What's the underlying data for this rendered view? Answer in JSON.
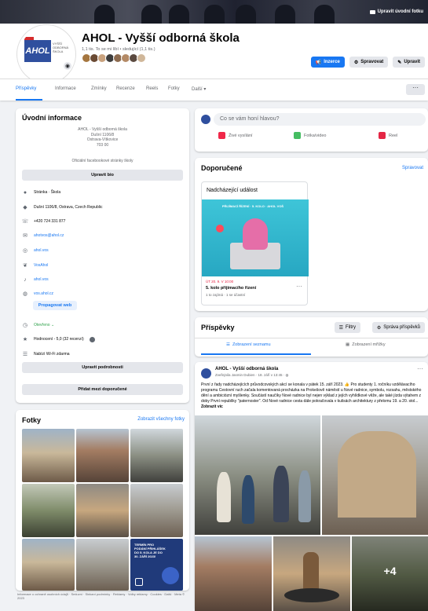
{
  "cover": {
    "button": "Upravit úvodní fotku"
  },
  "page": {
    "name": "AHOL - Vyšší odborná škola",
    "stats": "1,1 tis. To se mi líbí • sledující (1,1 tis.)",
    "logo_text": "AHOL",
    "logo_subtitle": "VYŠŠÍ ODBORNÁ ŠKOLA"
  },
  "header_buttons": {
    "primary": "Inzerce",
    "manage": "Spravovat",
    "edit": "Upravit"
  },
  "tabs": [
    "Příspěvky",
    "Informace",
    "Zmínky",
    "Recenze",
    "Reels",
    "Fotky",
    "Další ▾"
  ],
  "intro": {
    "title": "Úvodní informace",
    "bio_lines": [
      "AHOL - Vyšší odborná škola",
      "Dušní 1106/8",
      "Ostrava-Vítkovice",
      "703 00"
    ],
    "bio_note": "Oficiální facebookové stránky školy",
    "edit_bio": "Upravit bio",
    "rows": [
      {
        "icon": "info-icon",
        "text": "Stránka · Škola"
      },
      {
        "icon": "location-icon",
        "text": "Dušní 1106/8, Ostrava, Czech Republic"
      },
      {
        "icon": "phone-icon",
        "text": "+420 724 331 877"
      },
      {
        "icon": "mail-icon",
        "text": "ahotvos@ahol.cz"
      },
      {
        "icon": "instagram-icon",
        "text": "ahol.vos"
      },
      {
        "icon": "twitter-icon",
        "text": "VosAhol"
      },
      {
        "icon": "tiktok-icon",
        "text": "ahol.vos"
      },
      {
        "icon": "globe-icon",
        "text": "vos.ahol.cz"
      }
    ],
    "promote_web": "Propagovat web",
    "open_status": "Otevřeno ⌄",
    "rating": "Hodnocení - 5,0 (32 recenzí)",
    "wifi": "Nabízí Wi-Fi zdarma",
    "edit_details": "Upravit podrobnosti",
    "add_featured": "Přidat mezi doporučené"
  },
  "photos": {
    "title": "Fotky",
    "see_all": "Zobrazit všechny fotky",
    "promo_text": "TERMÍN PRO PODÁNÍ PŘIHLÁŠEK DO 5. KOLA JE DO 30. ZÁŘÍ 2023!"
  },
  "footer": "Informace o ochraně osobních údajů · Smluvní · Sinkaní podmínky · Reklamy · Volby reklamy · Cookies · Další · Meta © 2023",
  "composer": {
    "placeholder": "Co se vám honí hlavou?",
    "live": "Živé vysílání",
    "photo": "Fotka/video",
    "reel": "Reel"
  },
  "featured": {
    "title": "Doporučené",
    "manage": "Spravovat",
    "card_title": "Nadcházející událost",
    "event_image_text": "PŘIJÍMACÍ ŘÍZENÍ · 5. KOLO · AHOL VOŠ",
    "event_date": "ÚT 20. 9. V 10:00",
    "event_name": "5. kolo přijímacího řízení",
    "event_meta": "1 to zajímá · 1 se účastní"
  },
  "posts": {
    "title": "Příspěvky",
    "filters": "Filtry",
    "manage": "Správa příspěvků",
    "list_view": "Zobrazení seznamu",
    "grid_view": "Zobrazení mřížky",
    "post": {
      "author": "AHOL - Vyšší odborná škola",
      "meta": "Zveřejnila Jasmin Dubien · 18. září v 13:45 · ◍",
      "text": "První z řady nadcházejících průvodcovských akcí se konala v pátek 15. září 2023. 👍 Pro studenty 1. ročníku vzdělávacího programu Cestovní ruch začala komentovaná procházka na Prokešově náměstí u Nové radnice, symbolu, rozsahu, městského dění a ambiciózní myšlenky. Součástí naučíky Nové radnice byl nejen výklad z jejích vyhlídkové věže, ale také jízda výtahem z doby První republiky \"paternoster\". Od Nové radnice cesta dále pokračovala v kulisách architektury z přelomu 19. a 20. stol...",
      "more": "Zobrazit víc",
      "extra_count": "+4"
    }
  },
  "colors": {
    "accent": "#1877f2",
    "background": "#f0f2f5",
    "card": "#ffffff",
    "brand_blue": "#2f4f9e",
    "brand_red": "#d62b2b"
  }
}
